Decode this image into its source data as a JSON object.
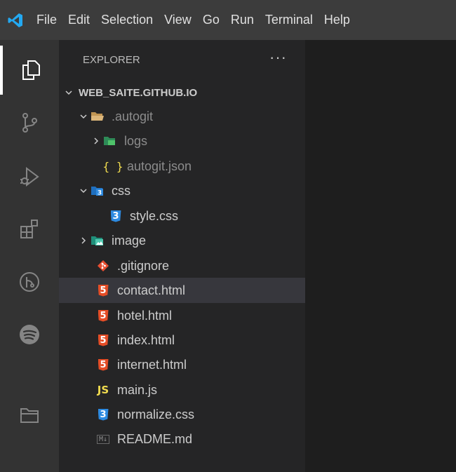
{
  "menubar": {
    "items": [
      "File",
      "Edit",
      "Selection",
      "View",
      "Go",
      "Run",
      "Terminal",
      "Help"
    ]
  },
  "activity_bar": {
    "icons": [
      "explorer-icon",
      "source-control-icon",
      "run-debug-icon",
      "extensions-icon",
      "git-graph-icon",
      "spotify-icon",
      "folder-icon"
    ]
  },
  "explorer": {
    "title": "EXPLORER",
    "more_actions": "···",
    "root": "WEB_SAITE.GITHUB.IO",
    "tree": {
      "autogit": ".autogit",
      "logs": "logs",
      "autogit_json": "autogit.json",
      "css": "css",
      "style_css": "style.css",
      "image": "image",
      "gitignore": ".gitignore",
      "contact_html": "contact.html",
      "hotel_html": "hotel.html",
      "index_html": "index.html",
      "internet_html": "internet.html",
      "main_js": "main.js",
      "normalize_css": "normalize.css",
      "readme_md": "README.md"
    },
    "selected": "contact.html",
    "icon_glyphs": {
      "html": "5",
      "css": "3",
      "js": "JS",
      "json": "{ }",
      "md": "M↓"
    }
  },
  "colors": {
    "accent": "#0078d4",
    "html": "#e44d26",
    "css": "#2d8ae0",
    "js": "#f1dc4f",
    "selected_row": "#37373d"
  }
}
